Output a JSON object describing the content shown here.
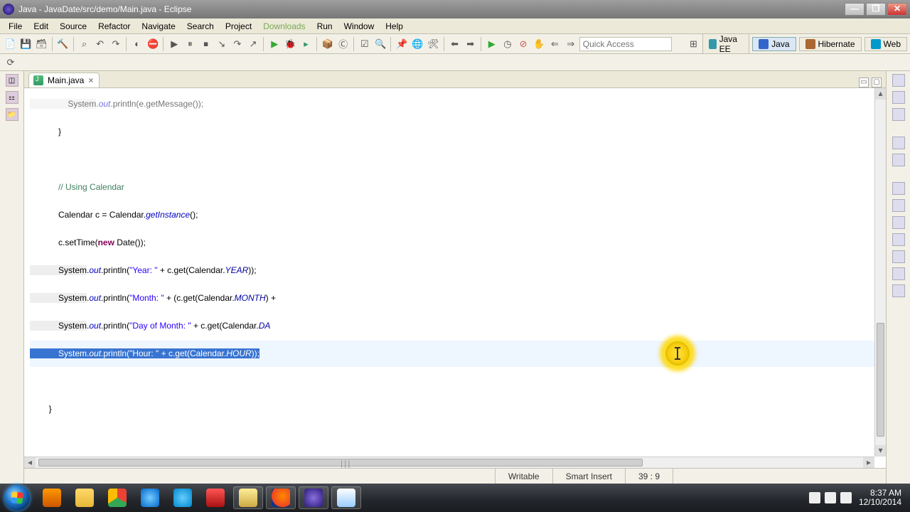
{
  "window": {
    "title": "Java - JavaDate/src/demo/Main.java - Eclipse"
  },
  "menu": {
    "items": [
      "File",
      "Edit",
      "Source",
      "Refactor",
      "Navigate",
      "Search",
      "Project",
      "Downloads",
      "Run",
      "Window",
      "Help"
    ]
  },
  "quickaccess": {
    "placeholder": "Quick Access"
  },
  "perspectives": [
    {
      "key": "javaee",
      "label": "Java EE",
      "active": false
    },
    {
      "key": "java",
      "label": "Java",
      "active": true
    },
    {
      "key": "hibernate",
      "label": "Hibernate",
      "active": false
    },
    {
      "key": "web",
      "label": "Web",
      "active": false
    }
  ],
  "tab": {
    "label": "Main.java"
  },
  "code": {
    "l0a": "                System",
    "l0b": ".",
    "l0c": "out",
    "l0d": ".println(e.getMessage());",
    "l1": "            }",
    "l2": "",
    "l3": "            // Using Calendar",
    "l4a": "            Calendar c = Calendar.",
    "l4b": "getInstance",
    "l4c": "();",
    "l5a": "            c.setTime(",
    "l5b": "new",
    "l5c": " Date());",
    "l6a": "            System",
    "l6b": ".",
    "l6c": "out",
    "l6d": ".println(",
    "l6e": "\"Year: \"",
    "l6f": " + c.get(Calendar.",
    "l6g": "YEAR",
    "l6h": "));",
    "l7a": "            System",
    "l7b": ".",
    "l7c": "out",
    "l7d": ".println(",
    "l7e": "\"Month: \"",
    "l7f": " + (c.get(Calendar.",
    "l7g": "MONTH",
    "l7h": ") +",
    "l8a": "            System",
    "l8b": ".",
    "l8c": "out",
    "l8d": ".println(",
    "l8e": "\"Day of Month: \"",
    "l8f": " + c.get(Calendar.",
    "l8g": "DA",
    "l9a": "            System",
    "l9b": ".",
    "l9c": "out",
    "l9d": ".println(",
    "l9e": "\"Hour: \"",
    "l9f": " + c.get(Calendar.",
    "l9g": "HOUR",
    "l9h": "));",
    "l10": "",
    "l11": "        }",
    "l12": "",
    "l13": "}"
  },
  "status": {
    "writable": "Writable",
    "insert": "Smart Insert",
    "pos": "39 : 9"
  },
  "taskbar": {
    "icons": [
      {
        "name": "start",
        "color": ""
      },
      {
        "name": "media-player",
        "color": "linear-gradient(#f90,#c50)"
      },
      {
        "name": "sticky-notes",
        "color": "linear-gradient(#ffd86b,#e6b838)"
      },
      {
        "name": "chrome",
        "color": "conic-gradient(#ea4335 0 33%,#34a853 0 66%,#fbbc05 0)"
      },
      {
        "name": "ie",
        "color": "radial-gradient(circle,#7cf,#06c)"
      },
      {
        "name": "skype",
        "color": "radial-gradient(circle,#6cf,#08c)"
      },
      {
        "name": "apache",
        "color": "linear-gradient(#f55,#a11)"
      },
      {
        "name": "explorer",
        "color": "linear-gradient(#fe9,#ca4)",
        "active": true
      },
      {
        "name": "firefox",
        "color": "radial-gradient(circle at 60% 40%,#f80,#e42 70%,#138 72%)",
        "active": true
      },
      {
        "name": "eclipse",
        "color": "radial-gradient(circle,#8a6fe0,#2a1a7a)",
        "active": true
      },
      {
        "name": "notepad",
        "color": "linear-gradient(#fff,#9cf)",
        "active": true
      }
    ],
    "time": "8:37 AM",
    "date": "12/10/2014"
  }
}
